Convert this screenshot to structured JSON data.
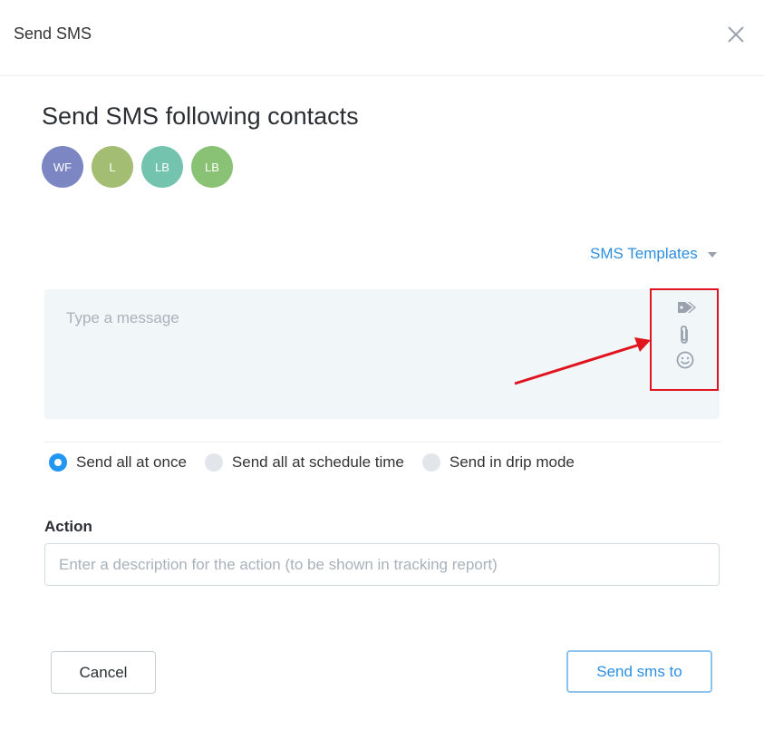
{
  "header": {
    "title": "Send SMS"
  },
  "main": {
    "heading": "Send SMS following contacts",
    "avatars": [
      {
        "initials": "WF",
        "color": "#7b86c2"
      },
      {
        "initials": "L",
        "color": "#a3bd72"
      },
      {
        "initials": "LB",
        "color": "#74c3ae"
      },
      {
        "initials": "LB",
        "color": "#89c275"
      }
    ],
    "templates_label": "SMS Templates",
    "message": {
      "placeholder": "Type a message",
      "value": "",
      "icons": [
        "tag-icon",
        "paperclip-icon",
        "smiley-icon"
      ]
    },
    "send_options": [
      {
        "label": "Send all at once",
        "checked": true
      },
      {
        "label": "Send all at schedule time",
        "checked": false
      },
      {
        "label": "Send in drip mode",
        "checked": false
      }
    ],
    "action": {
      "label": "Action",
      "placeholder": "Enter a description for the action (to be shown in tracking report)",
      "value": ""
    }
  },
  "footer": {
    "cancel_label": "Cancel",
    "send_label": "Send sms to"
  },
  "colors": {
    "accent": "#2d8ee0",
    "radio_checked": "#2196f3",
    "highlight": "#e0141e"
  }
}
